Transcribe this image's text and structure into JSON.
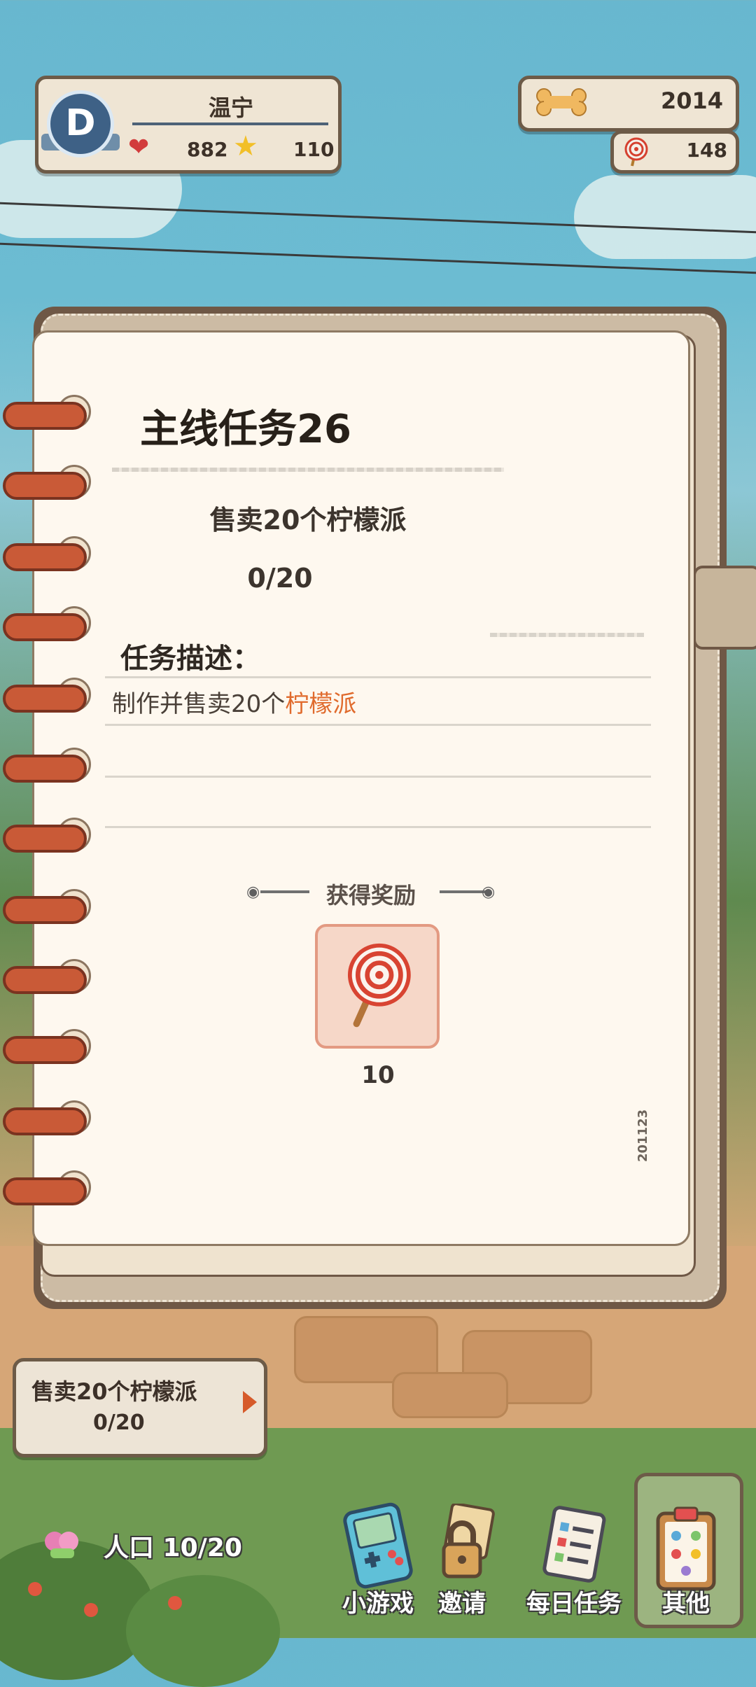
{
  "hud": {
    "user": {
      "rank_letter": "D",
      "name": "温宁",
      "hearts": "882",
      "stars": "110"
    },
    "currency": {
      "bones": "2014",
      "candy": "148"
    }
  },
  "quest_modal": {
    "title": "主线任务26",
    "subtitle": "售卖20个柠檬派",
    "progress": "0/20",
    "description_label": "任务描述：",
    "description_prefix": "制作并售卖20个",
    "description_highlight": "柠檬派",
    "reward_label": "获得奖励",
    "reward_icon": "lollipop-icon",
    "reward_count": "10",
    "page_id": "201123"
  },
  "tracker": {
    "title": "售卖20个柠檬派",
    "progress": "0/20"
  },
  "bottom_bar": {
    "population": "人口 10/20",
    "buttons": [
      {
        "label": "小游戏",
        "icon": "gameboy-icon"
      },
      {
        "label": "邀请",
        "icon": "lock-icon"
      },
      {
        "label": "每日任务",
        "icon": "checklist-icon"
      },
      {
        "label": "其他",
        "icon": "clipboard-icon"
      }
    ]
  },
  "colors": {
    "accent_orange": "#e06a2c",
    "panel_border": "#6d5b48",
    "page_bg": "#fef8ef"
  }
}
